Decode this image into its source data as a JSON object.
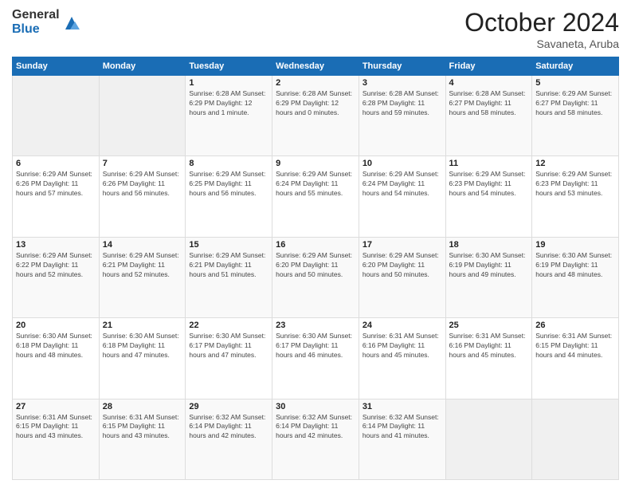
{
  "logo": {
    "general": "General",
    "blue": "Blue"
  },
  "header": {
    "month": "October 2024",
    "location": "Savaneta, Aruba"
  },
  "weekdays": [
    "Sunday",
    "Monday",
    "Tuesday",
    "Wednesday",
    "Thursday",
    "Friday",
    "Saturday"
  ],
  "weeks": [
    [
      {
        "day": "",
        "info": ""
      },
      {
        "day": "",
        "info": ""
      },
      {
        "day": "1",
        "info": "Sunrise: 6:28 AM\nSunset: 6:29 PM\nDaylight: 12 hours\nand 1 minute."
      },
      {
        "day": "2",
        "info": "Sunrise: 6:28 AM\nSunset: 6:29 PM\nDaylight: 12 hours\nand 0 minutes."
      },
      {
        "day": "3",
        "info": "Sunrise: 6:28 AM\nSunset: 6:28 PM\nDaylight: 11 hours\nand 59 minutes."
      },
      {
        "day": "4",
        "info": "Sunrise: 6:28 AM\nSunset: 6:27 PM\nDaylight: 11 hours\nand 58 minutes."
      },
      {
        "day": "5",
        "info": "Sunrise: 6:29 AM\nSunset: 6:27 PM\nDaylight: 11 hours\nand 58 minutes."
      }
    ],
    [
      {
        "day": "6",
        "info": "Sunrise: 6:29 AM\nSunset: 6:26 PM\nDaylight: 11 hours\nand 57 minutes."
      },
      {
        "day": "7",
        "info": "Sunrise: 6:29 AM\nSunset: 6:26 PM\nDaylight: 11 hours\nand 56 minutes."
      },
      {
        "day": "8",
        "info": "Sunrise: 6:29 AM\nSunset: 6:25 PM\nDaylight: 11 hours\nand 56 minutes."
      },
      {
        "day": "9",
        "info": "Sunrise: 6:29 AM\nSunset: 6:24 PM\nDaylight: 11 hours\nand 55 minutes."
      },
      {
        "day": "10",
        "info": "Sunrise: 6:29 AM\nSunset: 6:24 PM\nDaylight: 11 hours\nand 54 minutes."
      },
      {
        "day": "11",
        "info": "Sunrise: 6:29 AM\nSunset: 6:23 PM\nDaylight: 11 hours\nand 54 minutes."
      },
      {
        "day": "12",
        "info": "Sunrise: 6:29 AM\nSunset: 6:23 PM\nDaylight: 11 hours\nand 53 minutes."
      }
    ],
    [
      {
        "day": "13",
        "info": "Sunrise: 6:29 AM\nSunset: 6:22 PM\nDaylight: 11 hours\nand 52 minutes."
      },
      {
        "day": "14",
        "info": "Sunrise: 6:29 AM\nSunset: 6:21 PM\nDaylight: 11 hours\nand 52 minutes."
      },
      {
        "day": "15",
        "info": "Sunrise: 6:29 AM\nSunset: 6:21 PM\nDaylight: 11 hours\nand 51 minutes."
      },
      {
        "day": "16",
        "info": "Sunrise: 6:29 AM\nSunset: 6:20 PM\nDaylight: 11 hours\nand 50 minutes."
      },
      {
        "day": "17",
        "info": "Sunrise: 6:29 AM\nSunset: 6:20 PM\nDaylight: 11 hours\nand 50 minutes."
      },
      {
        "day": "18",
        "info": "Sunrise: 6:30 AM\nSunset: 6:19 PM\nDaylight: 11 hours\nand 49 minutes."
      },
      {
        "day": "19",
        "info": "Sunrise: 6:30 AM\nSunset: 6:19 PM\nDaylight: 11 hours\nand 48 minutes."
      }
    ],
    [
      {
        "day": "20",
        "info": "Sunrise: 6:30 AM\nSunset: 6:18 PM\nDaylight: 11 hours\nand 48 minutes."
      },
      {
        "day": "21",
        "info": "Sunrise: 6:30 AM\nSunset: 6:18 PM\nDaylight: 11 hours\nand 47 minutes."
      },
      {
        "day": "22",
        "info": "Sunrise: 6:30 AM\nSunset: 6:17 PM\nDaylight: 11 hours\nand 47 minutes."
      },
      {
        "day": "23",
        "info": "Sunrise: 6:30 AM\nSunset: 6:17 PM\nDaylight: 11 hours\nand 46 minutes."
      },
      {
        "day": "24",
        "info": "Sunrise: 6:31 AM\nSunset: 6:16 PM\nDaylight: 11 hours\nand 45 minutes."
      },
      {
        "day": "25",
        "info": "Sunrise: 6:31 AM\nSunset: 6:16 PM\nDaylight: 11 hours\nand 45 minutes."
      },
      {
        "day": "26",
        "info": "Sunrise: 6:31 AM\nSunset: 6:15 PM\nDaylight: 11 hours\nand 44 minutes."
      }
    ],
    [
      {
        "day": "27",
        "info": "Sunrise: 6:31 AM\nSunset: 6:15 PM\nDaylight: 11 hours\nand 43 minutes."
      },
      {
        "day": "28",
        "info": "Sunrise: 6:31 AM\nSunset: 6:15 PM\nDaylight: 11 hours\nand 43 minutes."
      },
      {
        "day": "29",
        "info": "Sunrise: 6:32 AM\nSunset: 6:14 PM\nDaylight: 11 hours\nand 42 minutes."
      },
      {
        "day": "30",
        "info": "Sunrise: 6:32 AM\nSunset: 6:14 PM\nDaylight: 11 hours\nand 42 minutes."
      },
      {
        "day": "31",
        "info": "Sunrise: 6:32 AM\nSunset: 6:14 PM\nDaylight: 11 hours\nand 41 minutes."
      },
      {
        "day": "",
        "info": ""
      },
      {
        "day": "",
        "info": ""
      }
    ]
  ]
}
